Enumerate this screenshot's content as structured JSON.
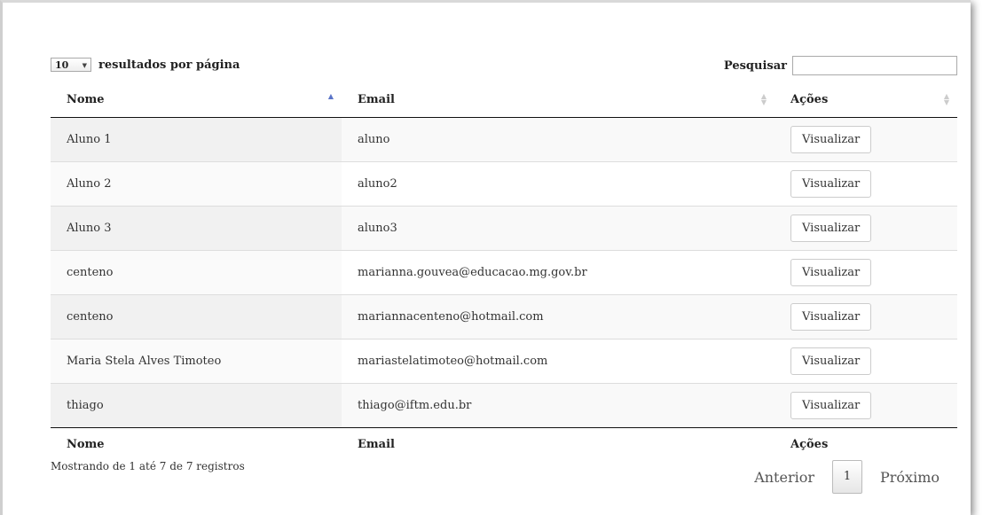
{
  "length_control": {
    "selected": "10",
    "label": "resultados por página"
  },
  "search": {
    "label": "Pesquisar",
    "value": ""
  },
  "table": {
    "headers": [
      "Nome",
      "Email",
      "Ações"
    ],
    "footers": [
      "Nome",
      "Email",
      "Ações"
    ],
    "rows": [
      {
        "nome": "Aluno 1",
        "email": "aluno",
        "action": "Visualizar"
      },
      {
        "nome": "Aluno 2",
        "email": "aluno2",
        "action": "Visualizar"
      },
      {
        "nome": "Aluno 3",
        "email": "aluno3",
        "action": "Visualizar"
      },
      {
        "nome": "centeno",
        "email": "marianna.gouvea@educacao.mg.gov.br",
        "action": "Visualizar"
      },
      {
        "nome": "centeno",
        "email": "mariannacenteno@hotmail.com",
        "action": "Visualizar"
      },
      {
        "nome": "Maria Stela Alves Timoteo",
        "email": "mariastelatimoteo@hotmail.com",
        "action": "Visualizar"
      },
      {
        "nome": "thiago",
        "email": "thiago@iftm.edu.br",
        "action": "Visualizar"
      }
    ]
  },
  "info": "Mostrando de 1 até 7 de 7 registros",
  "pagination": {
    "previous": "Anterior",
    "current": "1",
    "next": "Próximo"
  },
  "colors": {
    "sort_active": "#5b74c8",
    "sort_inactive": "#cccccc",
    "row_odd": "#f9f9f9"
  },
  "icons": {
    "sort_asc": "sort-ascending-icon",
    "sort_both": "sort-both-icon",
    "select_arrow": "dropdown-arrow-icon"
  }
}
